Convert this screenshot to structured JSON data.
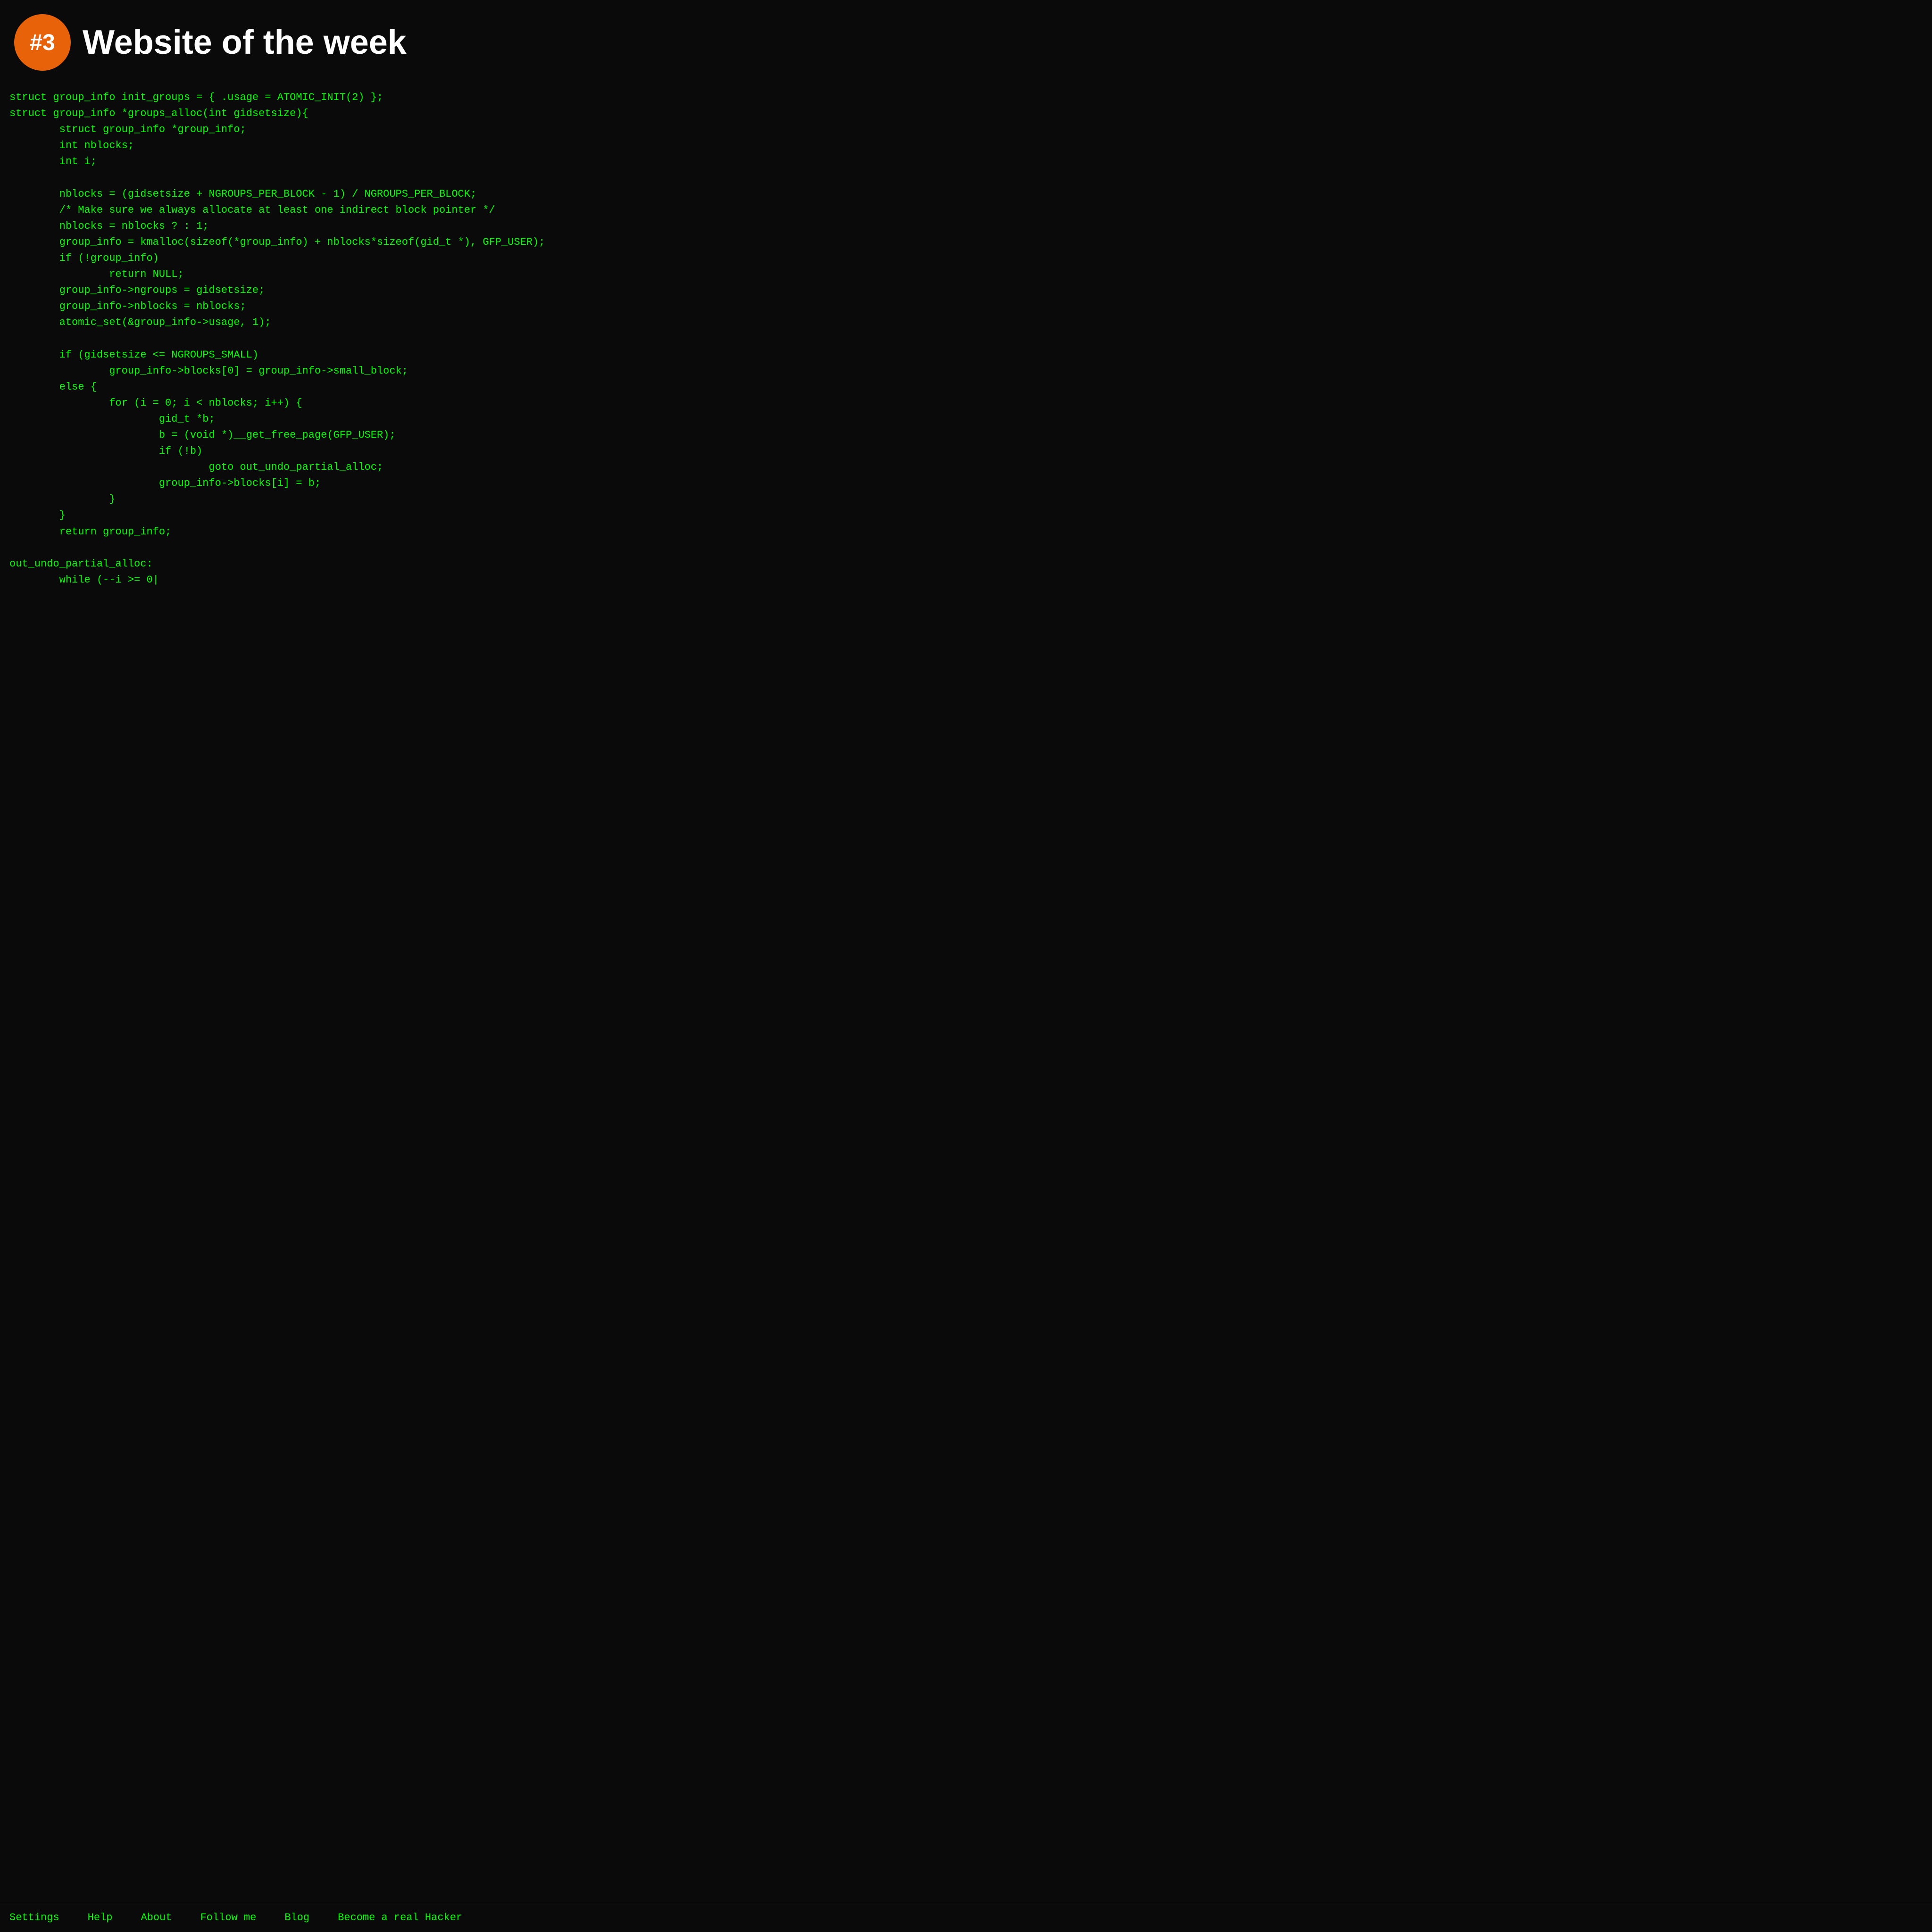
{
  "header": {
    "badge_label": "#3",
    "site_title": "Website of the week"
  },
  "code": {
    "content": "struct group_info init_groups = { .usage = ATOMIC_INIT(2) };\nstruct group_info *groups_alloc(int gidsetsize){\n        struct group_info *group_info;\n        int nblocks;\n        int i;\n\n        nblocks = (gidsetsize + NGROUPS_PER_BLOCK - 1) / NGROUPS_PER_BLOCK;\n        /* Make sure we always allocate at least one indirect block pointer */\n        nblocks = nblocks ? : 1;\n        group_info = kmalloc(sizeof(*group_info) + nblocks*sizeof(gid_t *), GFP_USER);\n        if (!group_info)\n                return NULL;\n        group_info->ngroups = gidsetsize;\n        group_info->nblocks = nblocks;\n        atomic_set(&group_info->usage, 1);\n\n        if (gidsetsize <= NGROUPS_SMALL)\n                group_info->blocks[0] = group_info->small_block;\n        else {\n                for (i = 0; i < nblocks; i++) {\n                        gid_t *b;\n                        b = (void *)__get_free_page(GFP_USER);\n                        if (!b)\n                                goto out_undo_partial_alloc;\n                        group_info->blocks[i] = b;\n                }\n        }\n        return group_info;\n\nout_undo_partial_alloc:\n        while (--i >= 0|"
  },
  "footer": {
    "links": [
      {
        "label": "Settings",
        "name": "settings-link"
      },
      {
        "label": "Help",
        "name": "help-link"
      },
      {
        "label": "About",
        "name": "about-link"
      },
      {
        "label": "Follow me",
        "name": "follow-me-link"
      },
      {
        "label": "Blog",
        "name": "blog-link"
      },
      {
        "label": "Become a real Hacker",
        "name": "hacker-link"
      }
    ]
  }
}
